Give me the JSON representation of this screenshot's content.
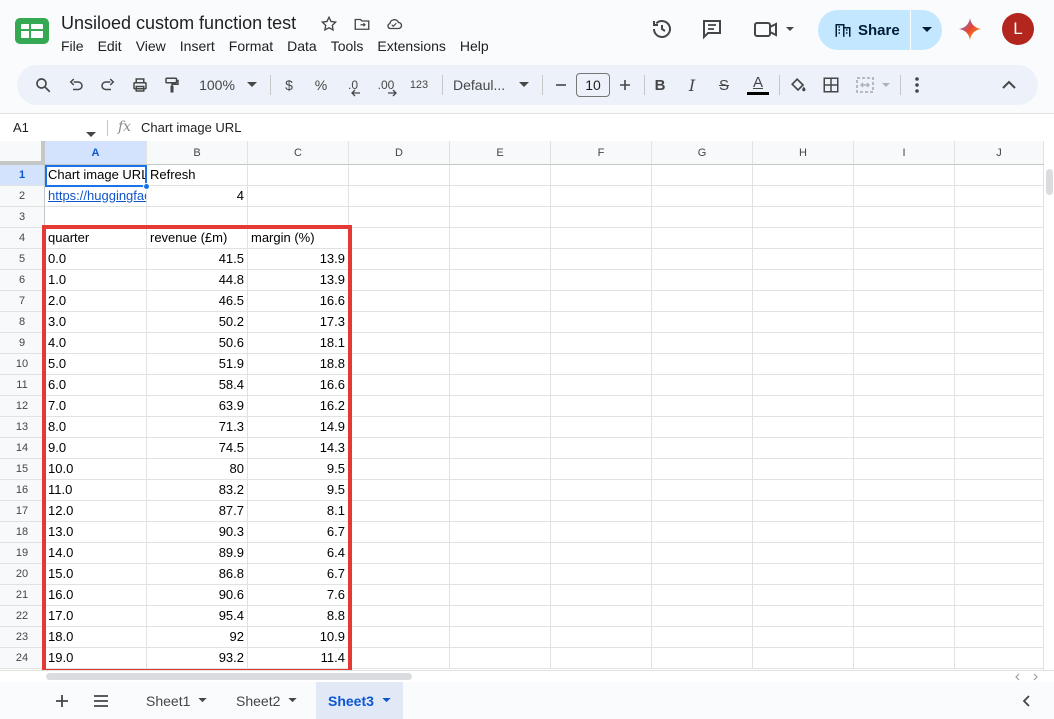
{
  "header": {
    "doc_title": "Unsiloed custom function test",
    "menu": [
      "File",
      "Edit",
      "View",
      "Insert",
      "Format",
      "Data",
      "Tools",
      "Extensions",
      "Help"
    ],
    "share_label": "Share",
    "avatar_letter": "L"
  },
  "toolbar": {
    "zoom": "100%",
    "currency": "$",
    "percent": "%",
    "dec_decrease": ".0",
    "dec_increase": ".00",
    "number_format": "123",
    "font_name": "Defaul...",
    "font_size": "10",
    "bold": "B",
    "italic": "I",
    "strike": "S",
    "text_color": "A"
  },
  "formula_bar": {
    "cell_ref": "A1",
    "fx": "fx",
    "value": "Chart image URL"
  },
  "columns": [
    "A",
    "B",
    "C",
    "D",
    "E",
    "F",
    "G",
    "H",
    "I",
    "J"
  ],
  "rows": [
    [
      "Chart image URL",
      "Refresh",
      ""
    ],
    [
      "https://huggingface",
      "4",
      ""
    ],
    [
      "",
      "",
      ""
    ],
    [
      "quarter",
      "revenue (£m)",
      "margin (%)"
    ],
    [
      "0.0",
      "41.5",
      "13.9"
    ],
    [
      "1.0",
      "44.8",
      "13.9"
    ],
    [
      "2.0",
      "46.5",
      "16.6"
    ],
    [
      "3.0",
      "50.2",
      "17.3"
    ],
    [
      "4.0",
      "50.6",
      "18.1"
    ],
    [
      "5.0",
      "51.9",
      "18.8"
    ],
    [
      "6.0",
      "58.4",
      "16.6"
    ],
    [
      "7.0",
      "63.9",
      "16.2"
    ],
    [
      "8.0",
      "71.3",
      "14.9"
    ],
    [
      "9.0",
      "74.5",
      "14.3"
    ],
    [
      "10.0",
      "80",
      "9.5"
    ],
    [
      "11.0",
      "83.2",
      "9.5"
    ],
    [
      "12.0",
      "87.7",
      "8.1"
    ],
    [
      "13.0",
      "90.3",
      "6.7"
    ],
    [
      "14.0",
      "89.9",
      "6.4"
    ],
    [
      "15.0",
      "86.8",
      "6.7"
    ],
    [
      "16.0",
      "90.6",
      "7.6"
    ],
    [
      "17.0",
      "95.4",
      "8.8"
    ],
    [
      "18.0",
      "92",
      "10.9"
    ],
    [
      "19.0",
      "93.2",
      "11.4"
    ]
  ],
  "sheets": [
    "Sheet1",
    "Sheet2",
    "Sheet3"
  ],
  "active_sheet": "Sheet3",
  "colors": {
    "accent": "#0b57d0",
    "share_bg": "#c2e7ff",
    "highlight_box": "#e53935",
    "avatar": "#b3261e"
  }
}
